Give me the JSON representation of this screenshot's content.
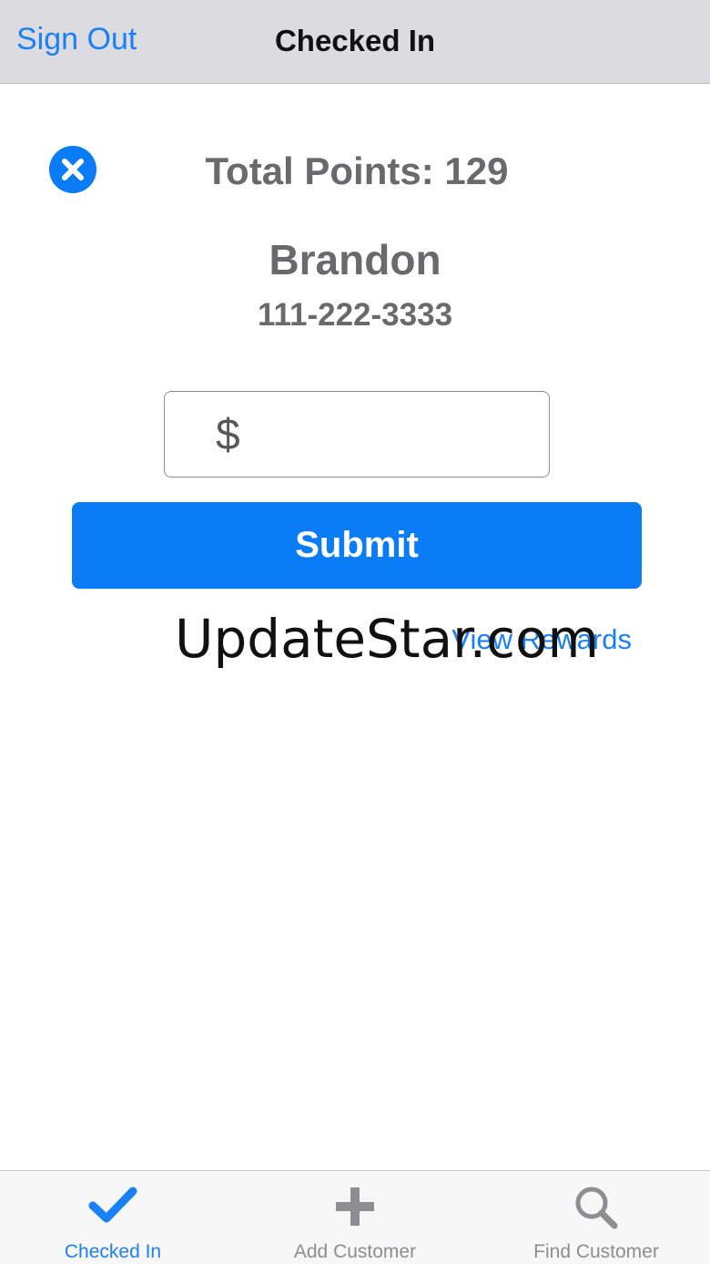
{
  "navbar": {
    "left_button": "Sign Out",
    "title": "Checked In"
  },
  "customer": {
    "total_points_label": "Total Points:",
    "total_points_value": "129",
    "name": "Brandon",
    "phone": "111-222-3333"
  },
  "amount": {
    "currency_symbol": "$",
    "value": ""
  },
  "actions": {
    "submit_label": "Submit",
    "view_rewards_label": "View Rewards"
  },
  "watermark": "UpdateStar.com",
  "tabbar": {
    "tabs": [
      {
        "label": "Checked In",
        "icon": "checkmark-icon",
        "active": true
      },
      {
        "label": "Add Customer",
        "icon": "plus-icon",
        "active": false
      },
      {
        "label": "Find Customer",
        "icon": "search-icon",
        "active": false
      }
    ]
  },
  "colors": {
    "accent": "#0a7cf5",
    "link": "#1a80f5",
    "text_gray": "#6a6a6c",
    "navbar_bg": "#dcdce0",
    "tab_inactive": "#8e8e92"
  }
}
